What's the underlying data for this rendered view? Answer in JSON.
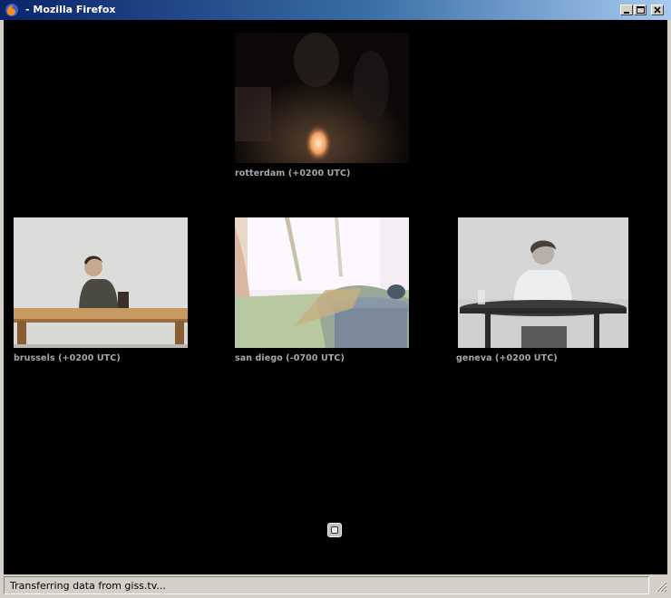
{
  "window": {
    "title": "- Mozilla Firefox",
    "controls": {
      "minimize_icon": "minimize-icon",
      "maximize_icon": "maximize-icon",
      "close_icon": "close-icon"
    }
  },
  "streams": [
    {
      "city": "rotterdam (+0200 UTC)"
    },
    {
      "city": "brussels (+0200 UTC)"
    },
    {
      "city": "san diego (-0700 UTC)"
    },
    {
      "city": "geneva (+0200 UTC)"
    }
  ],
  "loader_icon": "loading-icon",
  "status": {
    "text": "Transferring data from giss.tv..."
  },
  "colors": {
    "page_bg": "#000000",
    "caption": "#a8a8a8",
    "titlebar_start": "#0a246a",
    "titlebar_end": "#a6caf0"
  }
}
